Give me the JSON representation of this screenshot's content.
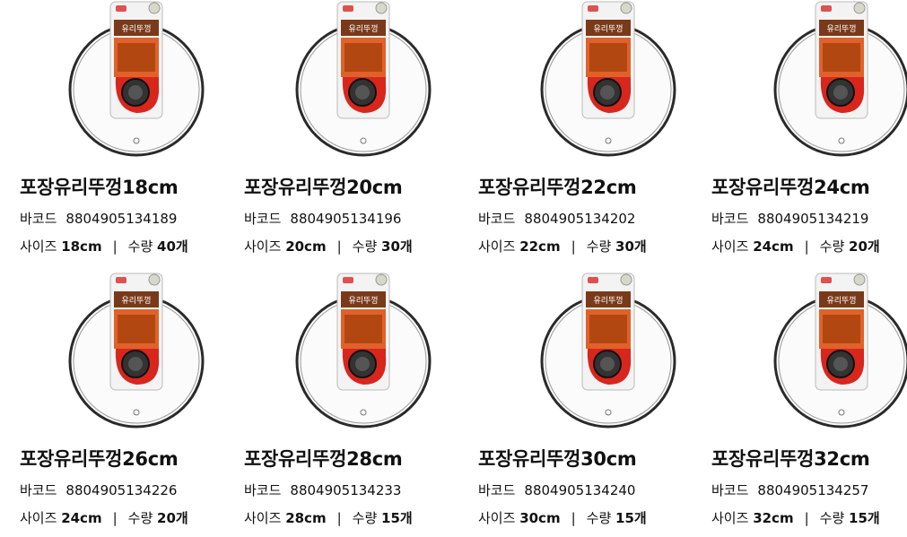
{
  "labels": {
    "barcode": "바코드",
    "size": "사이즈",
    "qty": "수량",
    "sep": "|"
  },
  "package": {
    "top_text": "유리뚜껑"
  },
  "products": [
    {
      "name": "포장유리뚜껑18cm",
      "barcode": "8804905134189",
      "size": "18cm",
      "qty": "40개"
    },
    {
      "name": "포장유리뚜껑20cm",
      "barcode": "8804905134196",
      "size": "20cm",
      "qty": "30개"
    },
    {
      "name": "포장유리뚜껑22cm",
      "barcode": "8804905134202",
      "size": "22cm",
      "qty": "30개"
    },
    {
      "name": "포장유리뚜껑24cm",
      "barcode": "8804905134219",
      "size": "24cm",
      "qty": "20개"
    },
    {
      "name": "포장유리뚜껑26cm",
      "barcode": "8804905134226",
      "size": "24cm",
      "qty": "20개"
    },
    {
      "name": "포장유리뚜껑28cm",
      "barcode": "8804905134233",
      "size": "28cm",
      "qty": "15개"
    },
    {
      "name": "포장유리뚜껑30cm",
      "barcode": "8804905134240",
      "size": "30cm",
      "qty": "15개"
    },
    {
      "name": "포장유리뚜껑32cm",
      "barcode": "8804905134257",
      "size": "32cm",
      "qty": "15개"
    }
  ],
  "colors": {
    "rim": "#2a2a2a",
    "handle_red": "#d9261c",
    "knob": "#333333",
    "card_orange": "#e0622a",
    "card_brown": "#7a3a1a"
  }
}
